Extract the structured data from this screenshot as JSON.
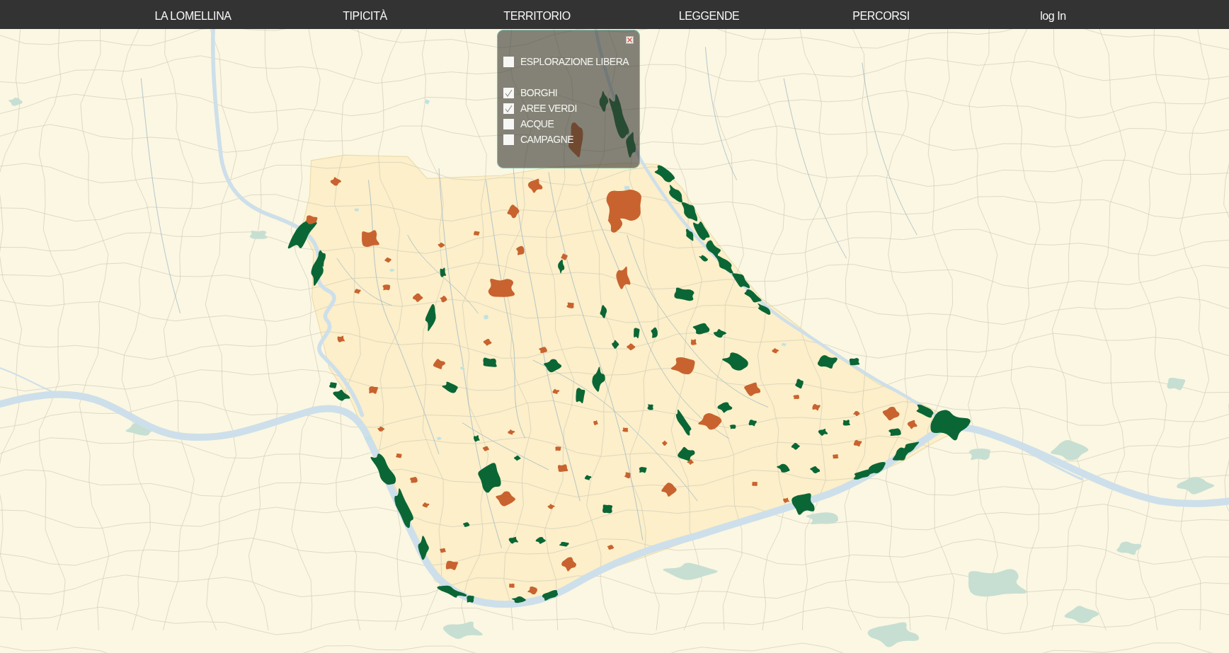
{
  "nav": {
    "items": [
      "LA LOMELLINA",
      "TIPICITÀ",
      "TERRITORIO",
      "LEGGENDE",
      "PERCORSI",
      "log In"
    ]
  },
  "layer_panel": {
    "options": [
      {
        "kind": "mode",
        "label": "ESPLORAZIONE LIBERA",
        "checked": false
      },
      {
        "kind": "layer",
        "label": "BORGHI",
        "checked": true
      },
      {
        "kind": "layer",
        "label": "AREE VERDI",
        "checked": true
      },
      {
        "kind": "layer",
        "label": "ACQUE",
        "checked": false
      },
      {
        "kind": "layer",
        "label": "CAMPAGNE",
        "checked": false
      }
    ]
  }
}
